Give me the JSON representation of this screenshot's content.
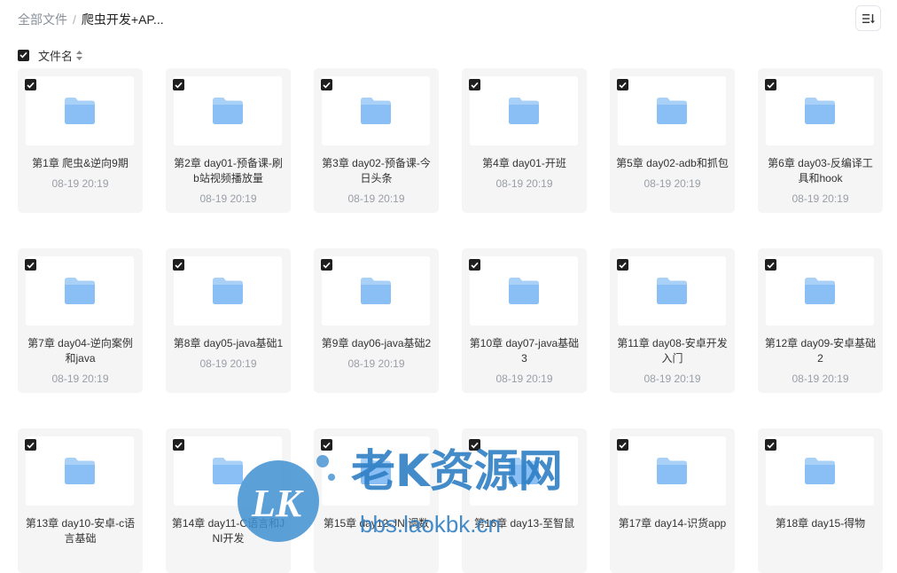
{
  "breadcrumb": {
    "root": "全部文件",
    "separator": "/",
    "current": "爬虫开发+AP..."
  },
  "toolbar": {
    "sort_icon": "sort-list-icon"
  },
  "list_header": {
    "label": "文件名",
    "select_all_checked": true
  },
  "folders": [
    {
      "name": "第1章 爬虫&逆向9期",
      "date": "08-19 20:19",
      "checked": true
    },
    {
      "name": "第2章 day01-预备课-刷b站视频播放量",
      "date": "08-19 20:19",
      "checked": true
    },
    {
      "name": "第3章 day02-预备课-今日头条",
      "date": "08-19 20:19",
      "checked": true
    },
    {
      "name": "第4章 day01-开班",
      "date": "08-19 20:19",
      "checked": true
    },
    {
      "name": "第5章 day02-adb和抓包",
      "date": "08-19 20:19",
      "checked": true
    },
    {
      "name": "第6章 day03-反编译工具和hook",
      "date": "08-19 20:19",
      "checked": true
    },
    {
      "name": "第7章 day04-逆向案例和java",
      "date": "08-19 20:19",
      "checked": true
    },
    {
      "name": "第8章 day05-java基础1",
      "date": "08-19 20:19",
      "checked": true
    },
    {
      "name": "第9章 day06-java基础2",
      "date": "08-19 20:19",
      "checked": true
    },
    {
      "name": "第10章 day07-java基础3",
      "date": "08-19 20:19",
      "checked": true
    },
    {
      "name": "第11章 day08-安卓开发入门",
      "date": "08-19 20:19",
      "checked": true
    },
    {
      "name": "第12章 day09-安卓基础2",
      "date": "08-19 20:19",
      "checked": true
    },
    {
      "name": "第13章 day10-安卓-c语言基础",
      "date": "",
      "checked": true
    },
    {
      "name": "第14章 day11-C语言和JNI开发",
      "date": "",
      "checked": true
    },
    {
      "name": "第15章 day12-JNI调数",
      "date": "",
      "checked": true
    },
    {
      "name": "第16章 day13-至智鼠",
      "date": "",
      "checked": true
    },
    {
      "name": "第17章 day14-识货app",
      "date": "",
      "checked": true
    },
    {
      "name": "第18章 day15-得物",
      "date": "",
      "checked": true
    }
  ],
  "watermark": {
    "logo": "LK",
    "title": "老K资源网",
    "url": "bbs.laokbk.cn"
  },
  "colors": {
    "folder_light": "#a9d1f8",
    "folder_dark": "#6fb1f2",
    "checkbox": "#1f1f1f"
  }
}
